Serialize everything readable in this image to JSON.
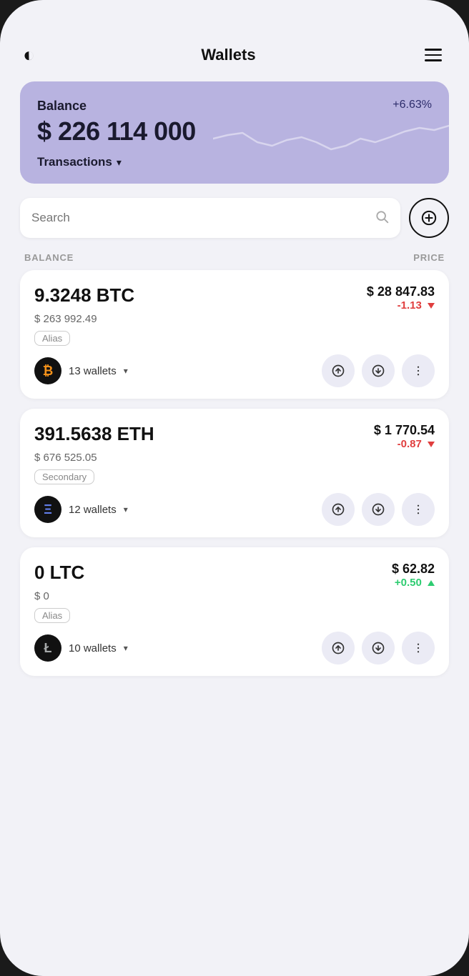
{
  "header": {
    "title": "Wallets",
    "logo": "◐",
    "menu_icon": "menu"
  },
  "balance_card": {
    "label": "Balance",
    "amount": "$ 226 114 000",
    "change": "+6.63%",
    "transactions_label": "Transactions"
  },
  "search": {
    "placeholder": "Search",
    "add_label": "+"
  },
  "columns": {
    "balance_label": "BALANCE",
    "price_label": "PRICE"
  },
  "crypto_list": [
    {
      "id": "btc",
      "amount": "9.3248 BTC",
      "usd_value": "$ 263 992.49",
      "price": "$ 28 847.83",
      "change": "-1.13",
      "change_direction": "down",
      "alias": "Alias",
      "wallets_count": "13 wallets",
      "coin_symbol": "₿",
      "coin_class": "coin-btc"
    },
    {
      "id": "eth",
      "amount": "391.5638 ETH",
      "usd_value": "$ 676 525.05",
      "price": "$ 1 770.54",
      "change": "-0.87",
      "change_direction": "down",
      "alias": "Secondary",
      "wallets_count": "12 wallets",
      "coin_symbol": "Ξ",
      "coin_class": "coin-eth"
    },
    {
      "id": "ltc",
      "amount": "0 LTC",
      "usd_value": "$ 0",
      "price": "$ 62.82",
      "change": "+0.50",
      "change_direction": "up",
      "alias": "Alias",
      "wallets_count": "10 wallets",
      "coin_symbol": "Ł",
      "coin_class": "coin-ltc"
    }
  ],
  "icons": {
    "search": "🔍",
    "send": "↑",
    "receive": "↓",
    "more": "⋮"
  }
}
